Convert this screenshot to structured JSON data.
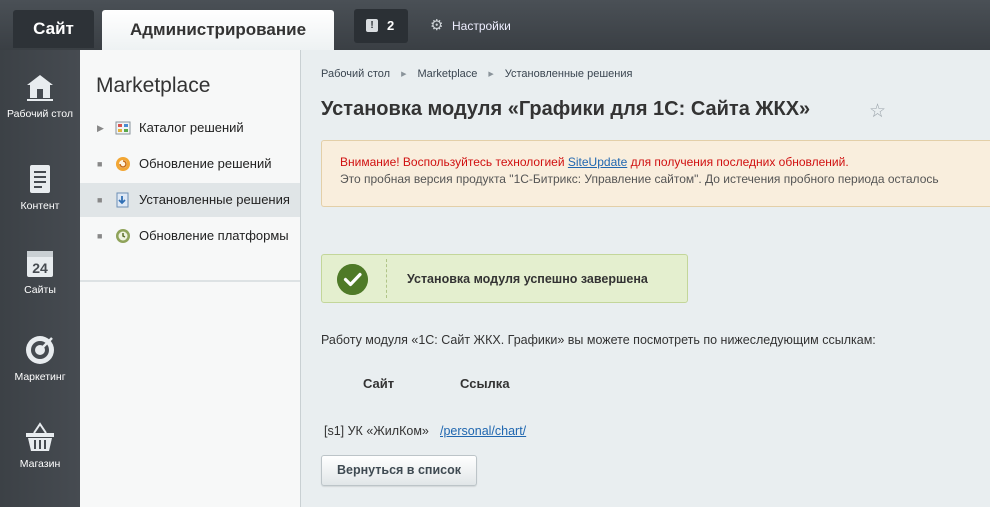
{
  "topbar": {
    "tab_site": "Сайт",
    "tab_admin": "Администрирование",
    "notifications_count": "2",
    "settings_label": "Настройки"
  },
  "rail": {
    "items": [
      {
        "label": "Рабочий стол",
        "icon": "home-icon"
      },
      {
        "label": "Контент",
        "icon": "document-icon"
      },
      {
        "label": "Сайты",
        "icon": "calendar-24-icon"
      },
      {
        "label": "Маркетинг",
        "icon": "target-icon"
      },
      {
        "label": "Магазин",
        "icon": "basket-icon"
      }
    ]
  },
  "submenu": {
    "title": "Marketplace",
    "items": [
      {
        "label": "Каталог решений",
        "icon": "catalog-icon",
        "active": false
      },
      {
        "label": "Обновление решений",
        "icon": "update-solutions-icon",
        "active": false
      },
      {
        "label": "Установленные решения",
        "icon": "installed-solutions-icon",
        "active": true
      },
      {
        "label": "Обновление платформы",
        "icon": "platform-update-icon",
        "active": false
      }
    ]
  },
  "main": {
    "breadcrumbs": [
      "Рабочий стол",
      "Marketplace",
      "Установленные решения"
    ],
    "title": "Установка модуля «Графики для 1С: Сайта ЖКХ»",
    "warning": {
      "line1_pre": "Внимание! Воспользуйтесь технологией ",
      "line1_link": "SiteUpdate",
      "line1_post": " для получения последних обновлений.",
      "line2": "Это пробная версия продукта \"1С-Битрикс: Управление сайтом\". До истечения пробного периода осталось"
    },
    "success_message": "Установка модуля успешно завершена",
    "info_text": "Работу модуля «1С: Сайт ЖКХ. Графики» вы можете посмотреть по нижеследующим ссылкам:",
    "table": {
      "headers": [
        "Сайт",
        "Ссылка"
      ],
      "rows": [
        {
          "site": "[s1] УК «ЖилКом»",
          "link": "/personal/chart/"
        }
      ]
    },
    "back_button": "Вернуться в список"
  },
  "colors": {
    "topbar": "#3f4449",
    "warning_text": "#d01010",
    "link": "#2067b0",
    "success_bg": "#e4efcf",
    "success_check": "#4f7a28"
  }
}
